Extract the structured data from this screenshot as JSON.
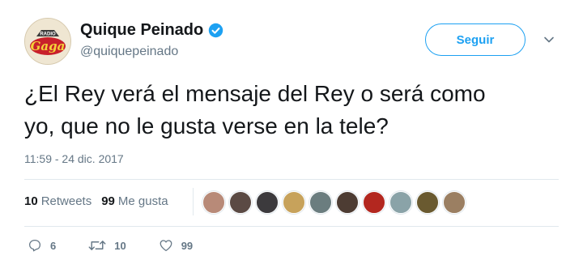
{
  "user": {
    "display_name": "Quique Peinado",
    "handle": "@quiquepeinado",
    "avatar_text_small": "RADIO",
    "avatar_text_big": "Gaga",
    "verified_icon": "verified-badge-icon"
  },
  "follow_button": {
    "label": "Seguir"
  },
  "tweet": {
    "line1": "¿El Rey verá el mensaje del Rey o será como",
    "line2": "yo, que no le gusta verse en la tele?",
    "timestamp": "11:59 - 24 dic. 2017"
  },
  "stats": {
    "retweets_count": "10",
    "retweets_label": "Retweets",
    "likes_count": "99",
    "likes_label": "Me gusta"
  },
  "likers": [
    "#b88a78",
    "#5b4a44",
    "#3c3a3d",
    "#c7a25b",
    "#6b7d7f",
    "#4d3c33",
    "#b3271f",
    "#8aa3a8",
    "#6a5a30",
    "#9b7f62"
  ],
  "actions": {
    "reply_count": "6",
    "retweet_count": "10",
    "like_count": "99"
  },
  "colors": {
    "accent": "#1da1f2",
    "secondary_text": "#657786"
  }
}
